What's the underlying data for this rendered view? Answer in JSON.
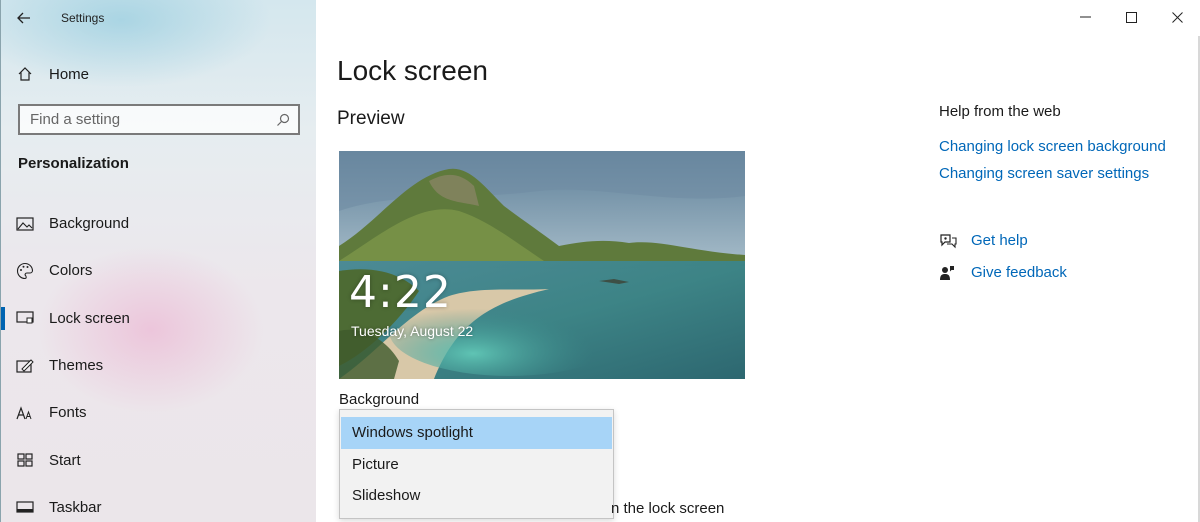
{
  "window": {
    "title": "Settings",
    "controls": {
      "minimize": "—",
      "maximize": "☐",
      "close": "✕"
    }
  },
  "sidebar": {
    "home_label": "Home",
    "search": {
      "placeholder": "Find a setting"
    },
    "section_title": "Personalization",
    "items": [
      {
        "label": "Background",
        "icon": "picture-icon"
      },
      {
        "label": "Colors",
        "icon": "palette-icon"
      },
      {
        "label": "Lock screen",
        "icon": "lock-screen-icon",
        "active": true
      },
      {
        "label": "Themes",
        "icon": "brush-icon"
      },
      {
        "label": "Fonts",
        "icon": "font-icon"
      },
      {
        "label": "Start",
        "icon": "start-grid-icon"
      },
      {
        "label": "Taskbar",
        "icon": "taskbar-icon"
      }
    ]
  },
  "main": {
    "page_title": "Lock screen",
    "preview_heading": "Preview",
    "preview": {
      "time": "4:22",
      "date": "Tuesday, August 22"
    },
    "background_label": "Background",
    "dropdown": {
      "options": [
        "Windows spotlight",
        "Picture",
        "Slideshow"
      ],
      "selected": "Windows spotlight"
    },
    "partial_text": "n the lock screen"
  },
  "help": {
    "heading": "Help from the web",
    "links": [
      "Changing lock screen background",
      "Changing screen saver settings"
    ],
    "get_help": "Get help",
    "give_feedback": "Give feedback"
  },
  "colors": {
    "accent": "#0063b1",
    "link": "#0067b8",
    "selection": "#a7d4f7"
  }
}
